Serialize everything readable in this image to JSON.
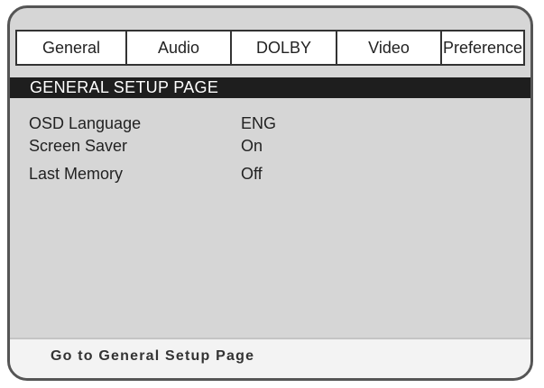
{
  "tabs": [
    {
      "label": "General"
    },
    {
      "label": "Audio"
    },
    {
      "label": "DOLBY"
    },
    {
      "label": "Video"
    },
    {
      "label": "Preference"
    }
  ],
  "header": {
    "title": "GENERAL SETUP PAGE"
  },
  "settings": [
    {
      "label": "OSD Language",
      "value": "ENG"
    },
    {
      "label": "Screen Saver",
      "value": "On"
    },
    {
      "label": "Last Memory",
      "value": "Off"
    }
  ],
  "status": {
    "text": "Go to General Setup Page"
  },
  "colors": {
    "frame_background": "#d6d6d6",
    "header_background": "#1e1e1e",
    "header_text": "#ffffff",
    "status_background": "#f3f3f3"
  }
}
